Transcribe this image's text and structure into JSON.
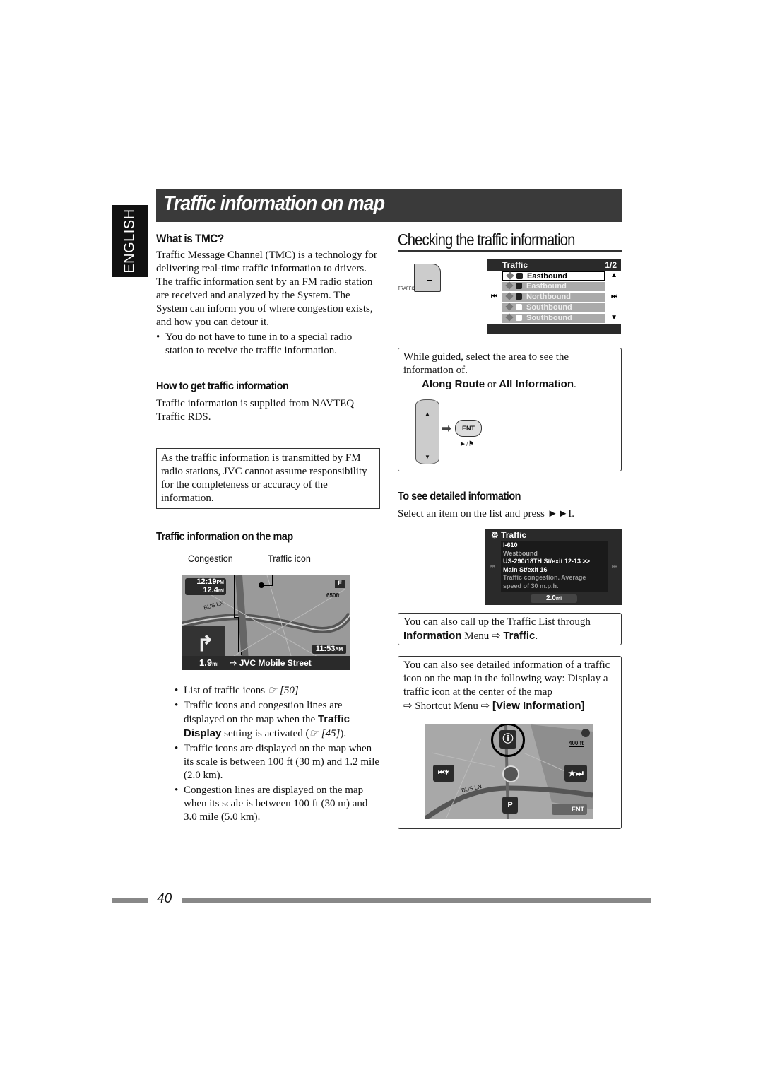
{
  "side_tab": "ENGLISH",
  "title": "Traffic information on map",
  "left": {
    "what_is_tmc": {
      "heading": "What is TMC?",
      "body": "Traffic Message Channel (TMC) is a technology for delivering real-time traffic information to drivers. The traffic information sent by an FM radio station are received and analyzed by the System. The System can inform you of where congestion exists, and how you can detour it.",
      "bullet": "You do not have to tune in to a special radio station to receive the traffic information."
    },
    "how_to_get": {
      "heading": "How to get traffic information",
      "body": "Traffic information is supplied from NAVTEQ Traffic RDS."
    },
    "notice": "As the traffic information is transmitted by FM radio stations, JVC cannot assume responsibility for the completeness or accuracy of the information.",
    "on_map": {
      "heading": "Traffic information on the map",
      "label_congestion": "Congestion",
      "label_traffic_icon": "Traffic icon",
      "screen": {
        "time": "12:19",
        "time_suffix": "PM",
        "distance": "12.4",
        "distance_unit": "mi",
        "compass": "E",
        "scale": "650ft",
        "road": "BUS LN",
        "clock": "11:53",
        "clock_suffix": "AM",
        "turn_distance": "1.9",
        "turn_unit": "mi",
        "street": "JVC Mobile Street"
      },
      "bullets": [
        {
          "text": "List of traffic icons ",
          "ref": "☞ [50]"
        },
        {
          "pre": "Traffic icons and congestion lines are displayed on the map when the ",
          "bold": "Traffic Display",
          "post": " setting is activated (",
          "ref": "☞ [45]",
          "end": ")."
        },
        {
          "text": "Traffic icons are displayed on the map when its scale is between 100 ft (30 m) and 1.2 mile (2.0 km)."
        },
        {
          "text": "Congestion lines are displayed on the map when its scale is between 100 ft (30 m) and 3.0 mile (5.0 km)."
        }
      ]
    }
  },
  "right": {
    "heading": "Checking the traffic information",
    "traffic_button_label": "TRAFFIC",
    "list_screen": {
      "title": "Traffic",
      "page": "1/2",
      "items": [
        "Eastbound",
        "Eastbound",
        "Northbound",
        "Southbound",
        "Southbound"
      ]
    },
    "step_box": {
      "text": "While guided, select the area to see the information of.",
      "opt1": "Along Route",
      "or": " or ",
      "opt2": "All Information",
      "end": ".",
      "ent_label": "ENT",
      "ent_sub": "►/⚑"
    },
    "detailed": {
      "heading": "To see detailed information",
      "body": "Select an item on the list and press ►►I.",
      "screen": {
        "title": "Traffic",
        "lines": [
          "I-610",
          "Westbound",
          "US-290/18TH St/exit 12-13 >>",
          "Main St/exit 16",
          "Traffic congestion. Average",
          "speed of 30 m.p.h."
        ],
        "distance": "2.0",
        "unit": "mi"
      }
    },
    "tip1": {
      "text": "You can also call up the Traffic List through",
      "b1": "Information",
      "mid": " Menu ⇨ ",
      "b2": "Traffic",
      "end": "."
    },
    "tip2": {
      "text": "You can also see detailed information of a traffic icon on the map in the following way: Display a traffic icon at the center of the map",
      "arrow": "⇨ Shortcut Menu ⇨ ",
      "bold": "[View Information]",
      "screen": {
        "scale": "400 ft",
        "road": "BUS LN",
        "ent": "ENT"
      }
    }
  },
  "page_number": "40"
}
